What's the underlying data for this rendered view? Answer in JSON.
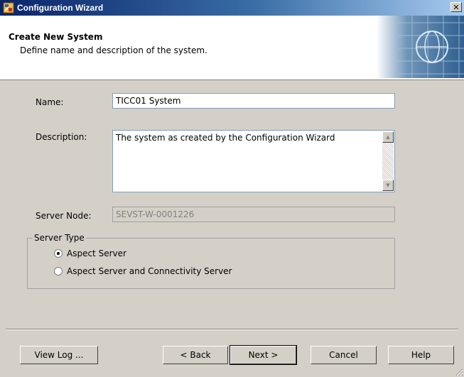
{
  "window": {
    "title": "Configuration Wizard",
    "close_glyph": "✕"
  },
  "header": {
    "title": "Create New System",
    "description": "Define name and description of the system.",
    "graphic_icon": "globe-network-icon"
  },
  "form": {
    "name_label": "Name:",
    "name_value": "TICC01 System",
    "description_label": "Description:",
    "description_value": "The system as created by the Configuration Wizard",
    "server_node_label": "Server Node:",
    "server_node_value": "SEVST-W-0001226"
  },
  "server_type": {
    "label": "Server Type",
    "options": [
      {
        "label": "Aspect Server",
        "selected": true
      },
      {
        "label": "Aspect Server and Connectivity Server",
        "selected": false
      }
    ]
  },
  "buttons": {
    "view_log": "View Log ...",
    "back": "< Back",
    "next": "Next >",
    "cancel": "Cancel",
    "help": "Help"
  },
  "colors": {
    "titlebar_start": "#0a246a",
    "titlebar_end": "#a6caf0",
    "face": "#d4d0c8"
  }
}
